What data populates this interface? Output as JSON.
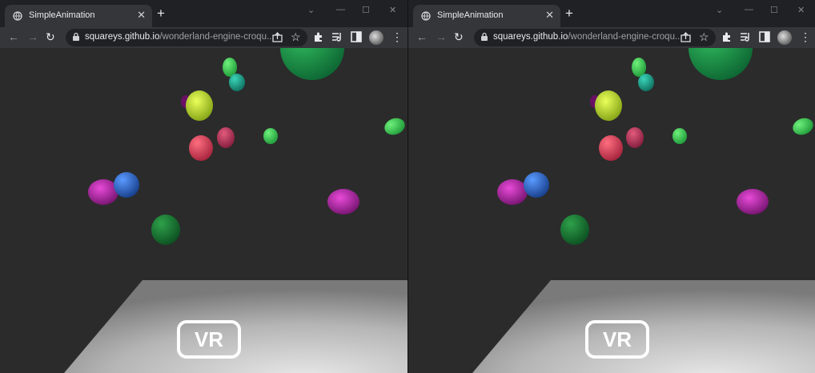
{
  "windows": [
    {
      "tab_title": "SimpleAnimation",
      "url_host": "squareys.github.io",
      "url_path": "/wonderland-engine-croqu...",
      "vr_label": "VR"
    },
    {
      "tab_title": "SimpleAnimation",
      "url_host": "squareys.github.io",
      "url_path": "/wonderland-engine-croqu...",
      "vr_label": "VR"
    }
  ],
  "colors": {
    "titlebar": "#202124",
    "toolbar": "#35363a",
    "scene_background": "#2b2b2b",
    "floor": "#bdbdbd"
  },
  "icons": [
    "globe-icon",
    "close-icon",
    "plus-icon",
    "chevron-down-icon",
    "minimize-icon",
    "maximize-icon",
    "back-icon",
    "forward-icon",
    "reload-icon",
    "lock-icon",
    "share-icon",
    "star-icon",
    "extensions-icon",
    "reading-list-icon",
    "sidebar-icon",
    "avatar",
    "kebab-menu-icon"
  ]
}
